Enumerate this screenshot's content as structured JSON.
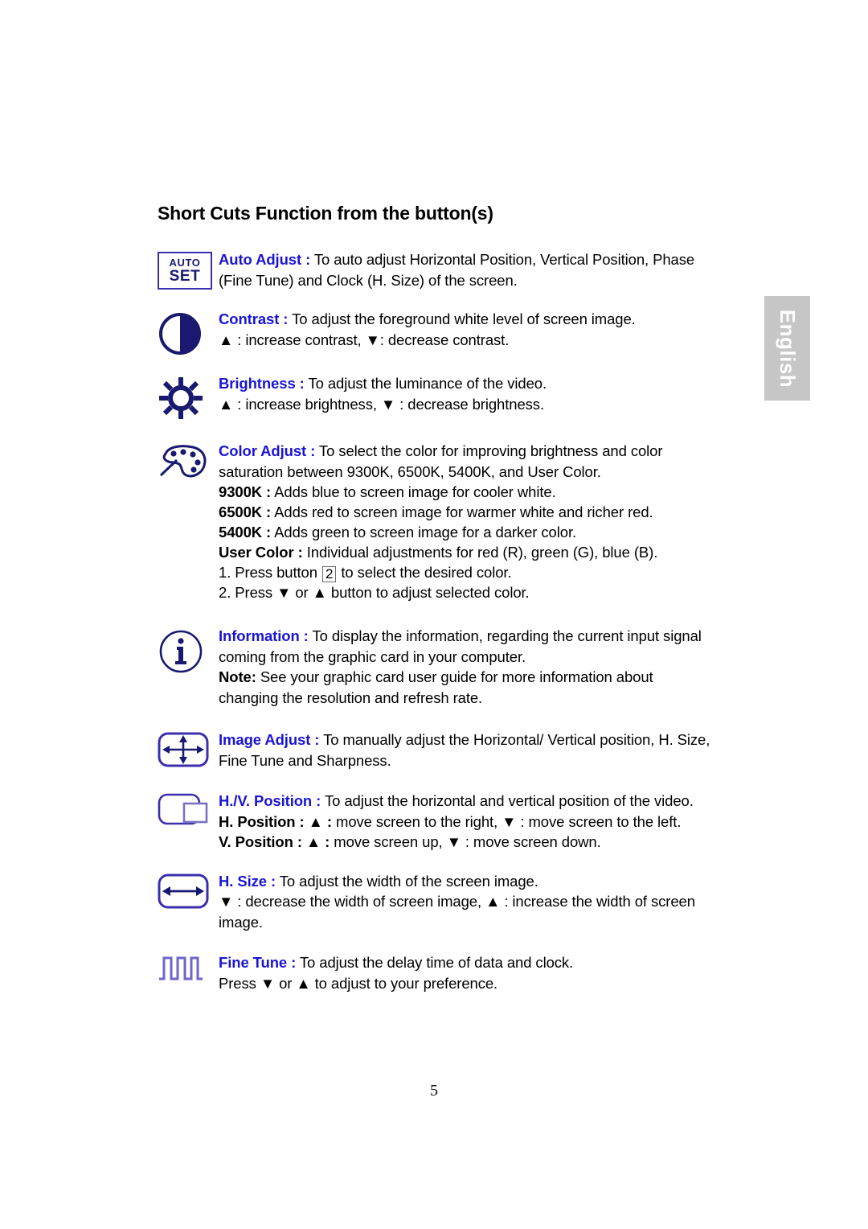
{
  "document": {
    "title": "Short Cuts Function from the button(s)",
    "page_number": "5",
    "language_tab": "English",
    "accent_color": "#1a14d6",
    "icon_color": "#191970",
    "tab_color": "#c6c6c6"
  },
  "sections": [
    {
      "icon": "auto-set-button-icon",
      "icon_text": {
        "line1": "AUTO",
        "line2": "SET"
      },
      "term": "Auto Adjust :",
      "lines": [
        " To auto adjust Horizontal Position, Vertical Position, Phase",
        "(Fine Tune) and Clock (H. Size) of the screen."
      ]
    },
    {
      "icon": "contrast-icon",
      "term": "Contrast :",
      "lines": [
        " To adjust the foreground white level of screen image.",
        "▲ : increase contrast, ▼: decrease contrast."
      ]
    },
    {
      "icon": "brightness-sun-icon",
      "term": "Brightness :",
      "lines": [
        " To adjust the luminance of the video.",
        "▲ : increase brightness, ▼ : decrease brightness."
      ]
    },
    {
      "icon": "color-palette-icon",
      "term": "Color Adjust :",
      "lines": [
        " To select the color for improving brightness and color",
        "saturation between 9300K, 6500K, 5400K, and User Color."
      ],
      "sub_items": [
        {
          "label": "9300K :",
          "text": " Adds blue to screen image for cooler white."
        },
        {
          "label": "6500K :",
          "text": " Adds red to screen image for warmer white and richer red."
        },
        {
          "label": "5400K :",
          "text": " Adds green to screen image for a darker color."
        },
        {
          "label": "User Color :",
          "text": " Individual adjustments for red (R), green (G), blue (B)."
        }
      ],
      "steps": [
        {
          "pre": "1. Press button ",
          "key": "2",
          "post": " to select the desired color."
        },
        {
          "pre": "2. Press ▼ or ▲ button to adjust selected color.",
          "key": "",
          "post": ""
        }
      ]
    },
    {
      "icon": "information-icon",
      "term": "Information :",
      "lines": [
        " To display the information, regarding the current input signal",
        "coming from the graphic card in your computer."
      ],
      "note_label": "Note:",
      "note_lines": [
        " See your graphic card user guide for more information about",
        "changing the resolution and refresh rate."
      ]
    },
    {
      "icon": "image-adjust-icon",
      "term": "Image Adjust :",
      "lines": [
        " To manually adjust the Horizontal/ Vertical position, H. Size,",
        "Fine Tune and Sharpness."
      ]
    },
    {
      "icon": "hv-position-icon",
      "term": "H./V. Position :",
      "lines": [
        " To adjust the horizontal and vertical position of the video."
      ],
      "bold_lines": [
        {
          "label": "H. Position : ▲ :",
          "text": " move screen to the right, ▼ : move screen to the left."
        },
        {
          "label": "V. Position : ▲ :",
          "text": " move screen up, ▼ : move screen down."
        }
      ]
    },
    {
      "icon": "h-size-icon",
      "term": "H. Size :",
      "lines": [
        " To adjust the width of the screen image.",
        "▼ : decrease the width of screen image, ▲ : increase the width of screen",
        "image."
      ]
    },
    {
      "icon": "fine-tune-icon",
      "term": "Fine Tune :",
      "lines": [
        " To adjust the delay time of data and clock.",
        "Press ▼ or ▲ to adjust to your preference."
      ]
    }
  ]
}
